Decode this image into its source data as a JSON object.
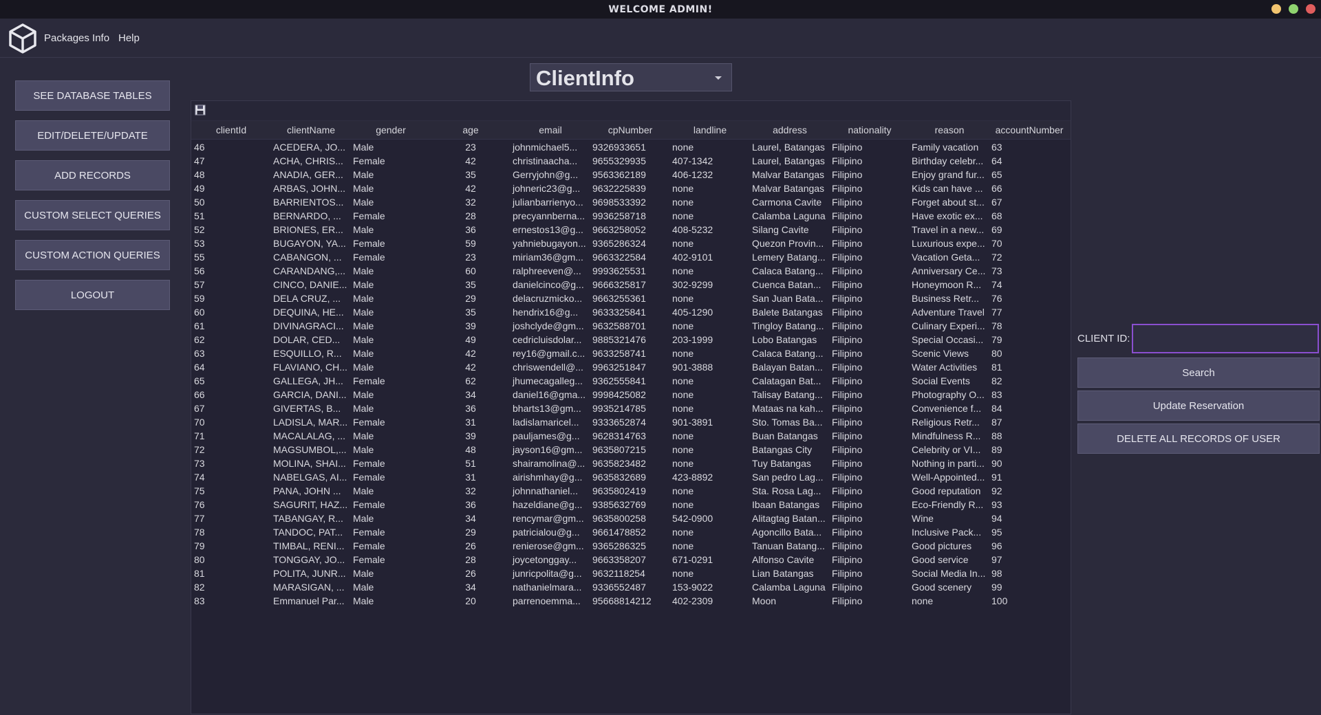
{
  "window": {
    "title": "WELCOME ADMIN!"
  },
  "menu": {
    "items": [
      "Packages Info",
      "Help"
    ]
  },
  "sidebar": {
    "buttons": [
      "SEE DATABASE TABLES",
      "EDIT/DELETE/UPDATE",
      "ADD RECORDS",
      "CUSTOM SELECT QUERIES",
      "CUSTOM ACTION QUERIES",
      "LOGOUT"
    ]
  },
  "table_select": {
    "value": "ClientInfo"
  },
  "grid": {
    "columns": [
      "clientId",
      "clientName",
      "gender",
      "age",
      "email",
      "cpNumber",
      "landline",
      "address",
      "nationality",
      "reason",
      "accountNumber"
    ],
    "rows": [
      [
        "46",
        "ACEDERA, JO...",
        "Male",
        "23",
        "johnmichael5...",
        "9326933651",
        "none",
        "Laurel, Batangas",
        "Filipino",
        "Family vacation",
        "63"
      ],
      [
        "47",
        "ACHA, CHRIS...",
        "Female",
        "42",
        "christinaacha...",
        "9655329935",
        "407-1342",
        "Laurel, Batangas",
        "Filipino",
        "Birthday celebr...",
        "64"
      ],
      [
        "48",
        "ANADIA, GER...",
        "Male",
        "35",
        "Gerryjohn@g...",
        "9563362189",
        "406-1232",
        "Malvar Batangas",
        "Filipino",
        "Enjoy grand fur...",
        "65"
      ],
      [
        "49",
        "ARBAS, JOHN...",
        "Male",
        "42",
        "johneric23@g...",
        "9632225839",
        "none",
        "Malvar Batangas",
        "Filipino",
        "Kids can have ...",
        "66"
      ],
      [
        "50",
        "BARRIENTOS...",
        "Male",
        "32",
        "julianbarrienyo...",
        "9698533392",
        "none",
        "Carmona Cavite",
        "Filipino",
        "Forget about st...",
        "67"
      ],
      [
        "51",
        "BERNARDO, ...",
        "Female",
        "28",
        "precyannberna...",
        "9936258718",
        "none",
        "Calamba Laguna",
        "Filipino",
        "Have exotic ex...",
        "68"
      ],
      [
        "52",
        "BRIONES, ER...",
        "Male",
        "36",
        "ernestos13@g...",
        "9663258052",
        "408-5232",
        "Silang Cavite",
        "Filipino",
        "Travel in a new...",
        "69"
      ],
      [
        "53",
        "BUGAYON, YA...",
        "Female",
        "59",
        "yahniebugayon...",
        "9365286324",
        "none",
        "Quezon Provin...",
        "Filipino",
        "Luxurious expe...",
        "70"
      ],
      [
        "55",
        "CABANGON, ...",
        "Female",
        "23",
        "miriam36@gm...",
        "9663322584",
        "402-9101",
        "Lemery Batang...",
        "Filipino",
        "Vacation Geta...",
        "72"
      ],
      [
        "56",
        "CARANDANG,...",
        "Male",
        "60",
        "ralphreeven@...",
        "9993625531",
        "none",
        "Calaca Batang...",
        "Filipino",
        "Anniversary Ce...",
        "73"
      ],
      [
        "57",
        "CINCO, DANIE...",
        "Male",
        "35",
        "danielcinco@g...",
        "9666325817",
        "302-9299",
        "Cuenca Batan...",
        "Filipino",
        "Honeymoon R...",
        "74"
      ],
      [
        "59",
        "DELA CRUZ, ...",
        "Male",
        "29",
        "delacruzmicko...",
        "9663255361",
        "none",
        "San Juan Bata...",
        "Filipino",
        "Business Retr...",
        "76"
      ],
      [
        "60",
        "DEQUINA, HE...",
        "Male",
        "35",
        "hendrix16@g...",
        "9633325841",
        "405-1290",
        "Balete Batangas",
        "Filipino",
        "Adventure Travel",
        "77"
      ],
      [
        "61",
        "DIVINAGRACI...",
        "Male",
        "39",
        "joshclyde@gm...",
        "9632588701",
        "none",
        "Tingloy Batang...",
        "Filipino",
        "Culinary Experi...",
        "78"
      ],
      [
        "62",
        "DOLAR, CED...",
        "Male",
        "49",
        "cedricluisdolar...",
        "9885321476",
        "203-1999",
        "Lobo Batangas",
        "Filipino",
        "Special Occasi...",
        "79"
      ],
      [
        "63",
        "ESQUILLO, R...",
        "Male",
        "42",
        "rey16@gmail.c...",
        "9633258741",
        "none",
        "Calaca Batang...",
        "Filipino",
        "Scenic Views",
        "80"
      ],
      [
        "64",
        "FLAVIANO, CH...",
        "Male",
        "42",
        "chriswendell@...",
        "9963251847",
        "901-3888",
        "Balayan Batan...",
        "Filipino",
        "Water Activities",
        "81"
      ],
      [
        "65",
        "GALLEGA, JH...",
        "Female",
        "62",
        "jhumecagalleg...",
        "9362555841",
        "none",
        "Calatagan Bat...",
        "Filipino",
        "Social Events",
        "82"
      ],
      [
        "66",
        "GARCIA, DANI...",
        "Male",
        "34",
        "daniel16@gma...",
        "9998425082",
        "none",
        "Talisay Batang...",
        "Filipino",
        "Photography O...",
        "83"
      ],
      [
        "67",
        "GIVERTAS, B...",
        "Male",
        "36",
        "bharts13@gm...",
        "9935214785",
        "none",
        "Mataas na kah...",
        "Filipino",
        "Convenience f...",
        "84"
      ],
      [
        "70",
        "LADISLA, MAR...",
        "Female",
        "31",
        "ladislamaricel...",
        "9333652874",
        "901-3891",
        "Sto. Tomas Ba...",
        "Filipino",
        "Religious Retr...",
        "87"
      ],
      [
        "71",
        "MACALALAG, ...",
        "Male",
        "39",
        "pauljames@g...",
        "9628314763",
        "none",
        "Buan Batangas",
        "Filipino",
        "Mindfulness R...",
        "88"
      ],
      [
        "72",
        "MAGSUMBOL,...",
        "Male",
        "48",
        "jayson16@gm...",
        "9635807215",
        "none",
        "Batangas City",
        "Filipino",
        "Celebrity or VI...",
        "89"
      ],
      [
        "73",
        "MOLINA, SHAI...",
        "Female",
        "51",
        "shairamolina@...",
        "9635823482",
        "none",
        "Tuy Batangas",
        "Filipino",
        "Nothing in parti...",
        "90"
      ],
      [
        "74",
        "NABELGAS, AI...",
        "Female",
        "31",
        "airishmhay@g...",
        "9635832689",
        "423-8892",
        "San pedro Lag...",
        "Filipino",
        "Well-Appointed...",
        "91"
      ],
      [
        "75",
        "PANA, JOHN ...",
        "Male",
        "32",
        "johnnathaniel...",
        "9635802419",
        "none",
        "Sta. Rosa Lag...",
        "Filipino",
        "Good reputation",
        "92"
      ],
      [
        "76",
        "SAGURIT, HAZ...",
        "Female",
        "36",
        "hazeldiane@g...",
        "9385632769",
        "none",
        "Ibaan Batangas",
        "Filipino",
        "Eco-Friendly R...",
        "93"
      ],
      [
        "77",
        "TABANGAY, R...",
        "Male",
        "34",
        "rencymar@gm...",
        "9635800258",
        "542-0900",
        "Alitagtag Batan...",
        "Filipino",
        "Wine",
        "94"
      ],
      [
        "78",
        "TANDOC, PAT...",
        "Female",
        "29",
        "patricialou@g...",
        "9661478852",
        "none",
        "Agoncillo Bata...",
        "Filipino",
        "Inclusive Pack...",
        "95"
      ],
      [
        "79",
        "TIMBAL, RENI...",
        "Female",
        "26",
        "renierose@gm...",
        "9365286325",
        "none",
        "Tanuan Batang...",
        "Filipino",
        "Good pictures",
        "96"
      ],
      [
        "80",
        "TONGGAY, JO...",
        "Female",
        "28",
        "joycetonggay...",
        "9663358207",
        "671-0291",
        "Alfonso Cavite",
        "Filipino",
        "Good service",
        "97"
      ],
      [
        "81",
        "POLITA, JUNR...",
        "Male",
        "26",
        "junricpolita@g...",
        "9632118254",
        "none",
        "Lian Batangas",
        "Filipino",
        "Social Media In...",
        "98"
      ],
      [
        "82",
        "MARASIGAN, ...",
        "Male",
        "34",
        "nathanielmara...",
        "9336552487",
        "153-9022",
        "Calamba Laguna",
        "Filipino",
        "Good scenery",
        "99"
      ],
      [
        "83",
        "Emmanuel Par...",
        "Male",
        "20",
        "parrenoemma...",
        "95668814212",
        "402-2309",
        "Moon",
        "Filipino",
        "none",
        "100"
      ]
    ]
  },
  "client_panel": {
    "label": "CLIENT ID:",
    "input_value": "",
    "buttons": [
      "Search",
      "Update Reservation",
      "DELETE ALL RECORDS OF USER"
    ]
  },
  "colors": {
    "background": "#2b2a3b",
    "titlebar": "#17161f",
    "button": "#4a4963",
    "focus_border": "#8a4fd0",
    "win_minimize": "#f2c46f",
    "win_maximize": "#8fd36f",
    "win_close": "#e05d5d"
  },
  "icons": {
    "logo": "cube-icon",
    "save": "save-icon",
    "dropdown": "chevron-down-icon"
  }
}
